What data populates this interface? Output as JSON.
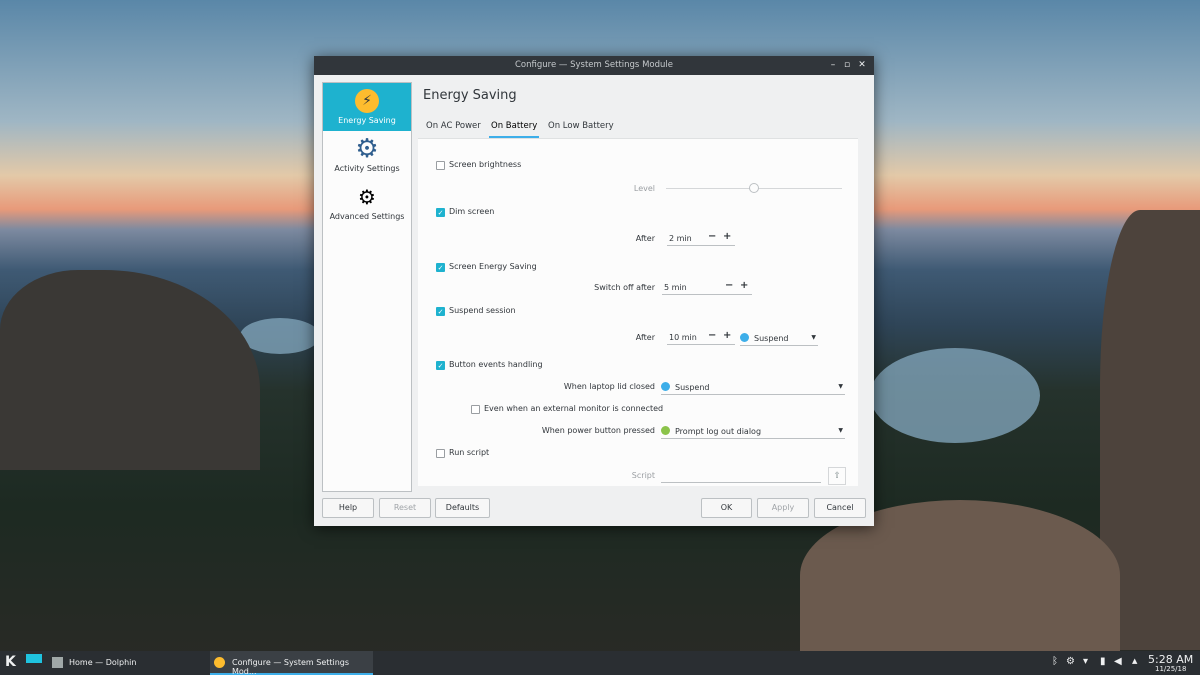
{
  "window": {
    "title": "Configure — System Settings Module",
    "controls": [
      "minimize",
      "maximize",
      "close"
    ]
  },
  "sidebar": {
    "items": [
      {
        "label": "Energy Saving",
        "selected": true
      },
      {
        "label": "Activity Settings"
      },
      {
        "label": "Advanced Settings"
      }
    ]
  },
  "page_title": "Energy Saving",
  "tabs": [
    {
      "label": "On AC Power"
    },
    {
      "label": "On Battery",
      "active": true
    },
    {
      "label": "On Low Battery"
    }
  ],
  "settings": {
    "screen_brightness": {
      "label": "Screen brightness",
      "checked": false,
      "level_label": "Level",
      "level": 0.5
    },
    "dim_screen": {
      "label": "Dim screen",
      "checked": true,
      "after_label": "After",
      "value": "2 min"
    },
    "screen_energy_saving": {
      "label": "Screen Energy Saving",
      "checked": true,
      "after_label": "Switch off after",
      "value": "5 min"
    },
    "suspend_session": {
      "label": "Suspend session",
      "checked": true,
      "after_label": "After",
      "value": "10 min",
      "action": "Suspend"
    },
    "button_events": {
      "label": "Button events handling",
      "checked": true,
      "lid_label": "When laptop lid closed",
      "lid_action": "Suspend",
      "external_monitor_label": "Even when an external monitor is connected",
      "external_monitor_checked": false,
      "power_label": "When power button pressed",
      "power_action": "Prompt log out dialog"
    },
    "run_script": {
      "label": "Run script",
      "checked": false,
      "script_label": "Script",
      "script_value": ""
    }
  },
  "buttons": {
    "help": "Help",
    "reset": "Reset",
    "defaults": "Defaults",
    "ok": "OK",
    "apply": "Apply",
    "cancel": "Cancel"
  },
  "taskbar": {
    "tasks": [
      {
        "label": "Home — Dolphin"
      },
      {
        "label": "Configure — System Settings Mod...",
        "active": true
      }
    ],
    "time": "5:28 AM",
    "date": "11/25/18"
  },
  "colors": {
    "accent": "#1eb2cf",
    "titlebar": "#31363b",
    "taskbar": "#2a2e32"
  }
}
